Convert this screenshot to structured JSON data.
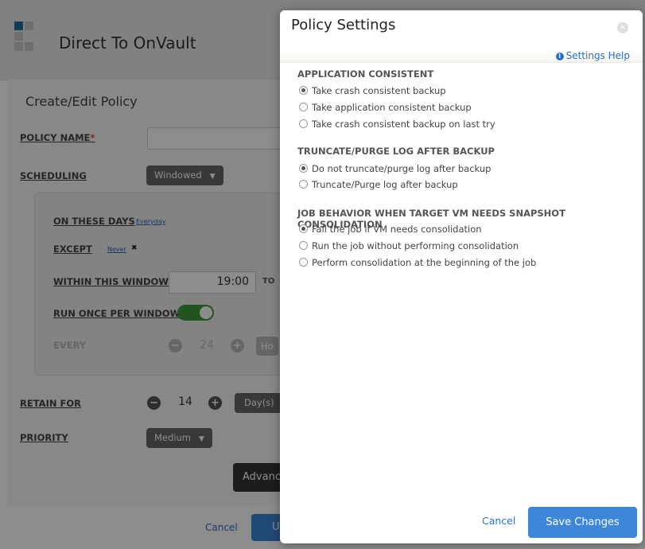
{
  "app": {
    "title": "Direct To OnVault",
    "panel_title": "Create/Edit Policy",
    "policy_name_label": "POLICY NAME",
    "required_mark": "*",
    "scheduling_label": "SCHEDULING",
    "scheduling_value": "Windowed",
    "on_these_days_label": "ON THESE DAYS",
    "on_these_days_value": "Everyday",
    "except_label": "EXCEPT",
    "except_value": "Never",
    "except_remove": "✖",
    "within_window_label": "WITHIN THIS WINDOW",
    "window_start": "19:00",
    "window_to": "TO",
    "run_once_label": "RUN ONCE PER WINDOW",
    "every_label": "EVERY",
    "every_value": "24",
    "every_unit": "Ho",
    "retain_label": "RETAIN FOR",
    "retain_value": "14",
    "retain_unit": "Day(s)",
    "priority_label": "PRIORITY",
    "priority_value": "Medium",
    "advanced_label": "Advance",
    "cancel_label": "Cancel",
    "update_label": "U"
  },
  "modal": {
    "title": "Policy Settings",
    "close_icon": "×",
    "help_icon": "i",
    "help_label": "Settings Help",
    "sections": [
      {
        "heading": "APPLICATION CONSISTENT",
        "options": [
          {
            "label": "Take crash consistent backup",
            "selected": true
          },
          {
            "label": "Take application consistent backup",
            "selected": false
          },
          {
            "label": "Take crash consistent backup on last try",
            "selected": false
          }
        ]
      },
      {
        "heading": "TRUNCATE/PURGE LOG AFTER BACKUP",
        "options": [
          {
            "label": "Do not truncate/purge log after backup",
            "selected": true
          },
          {
            "label": "Truncate/Purge log after backup",
            "selected": false
          }
        ]
      },
      {
        "heading": "JOB BEHAVIOR WHEN TARGET VM NEEDS SNAPSHOT CONSOLIDATION",
        "options": [
          {
            "label": "Fail the job if VM needs consolidation",
            "selected": true
          },
          {
            "label": "Run the job without performing consolidation",
            "selected": false
          },
          {
            "label": "Perform consolidation at the beginning of the job",
            "selected": false
          }
        ]
      }
    ],
    "cancel_label": "Cancel",
    "save_label": "Save Changes"
  },
  "colors": {
    "accent": "#3d86d8",
    "toggle_on": "#3f9b38",
    "link": "#2a6fc9"
  }
}
